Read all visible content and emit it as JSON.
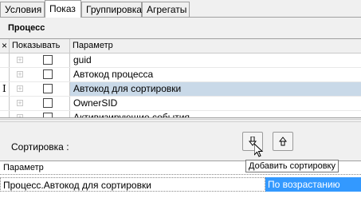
{
  "tabs": [
    {
      "label": "Условия"
    },
    {
      "label": "Показ"
    },
    {
      "label": "Группировка"
    },
    {
      "label": "Агрегаты"
    }
  ],
  "active_tab": "Показ",
  "section_title": "Процесс",
  "grid": {
    "columns": {
      "close": "×",
      "show": "Показывать",
      "param": "Параметр"
    },
    "rows": [
      {
        "param": "guid",
        "show": false
      },
      {
        "param": "Автокод процесса",
        "show": false
      },
      {
        "param": "Автокод для сортировки",
        "show": false,
        "selected": true
      },
      {
        "param": "OwnerSID",
        "show": false
      },
      {
        "param": "Активизирующие события",
        "show": false
      }
    ]
  },
  "sort": {
    "label": "Сортировка :",
    "add_button_icon": "arrow-down-icon",
    "remove_button_icon": "arrow-up-icon",
    "tooltip": "Добавить сортировку",
    "header": "Параметр",
    "rows": [
      {
        "name": "Процесс.Автокод для сортировки",
        "order": "По возрастанию"
      }
    ]
  },
  "colors": {
    "selection": "#3399ff",
    "row_highlight": "#c9d9e8"
  }
}
